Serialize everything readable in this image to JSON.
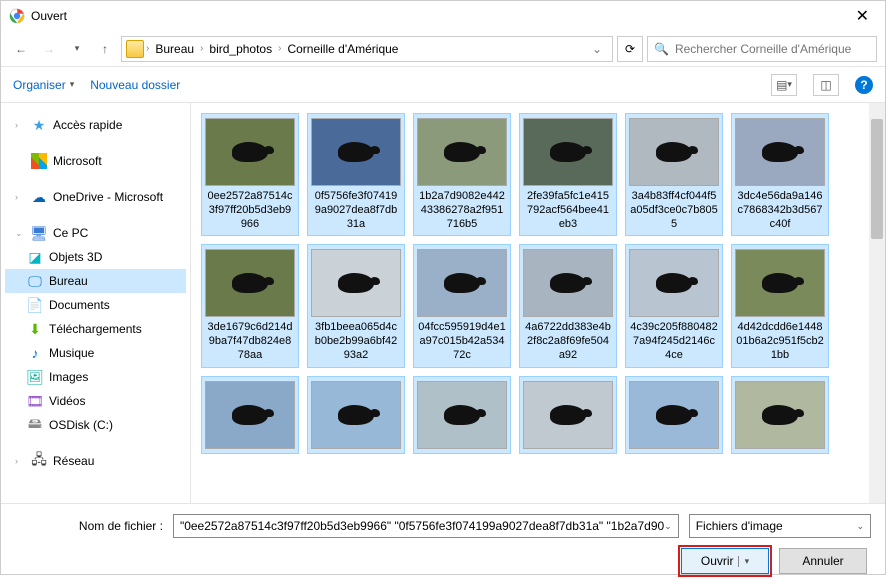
{
  "window": {
    "title": "Ouvert"
  },
  "nav": {
    "crumbs": [
      "Bureau",
      "bird_photos",
      "Corneille d'Amérique"
    ]
  },
  "search": {
    "placeholder": "Rechercher Corneille d'Amérique"
  },
  "toolbar": {
    "organize": "Organiser",
    "new_folder": "Nouveau dossier"
  },
  "sidebar": {
    "quick": "Accès rapide",
    "microsoft": "Microsoft",
    "onedrive": "OneDrive - Microsoft",
    "this_pc": "Ce PC",
    "items": [
      {
        "label": "Objets 3D"
      },
      {
        "label": "Bureau"
      },
      {
        "label": "Documents"
      },
      {
        "label": "Téléchargements"
      },
      {
        "label": "Musique"
      },
      {
        "label": "Images"
      },
      {
        "label": "Vidéos"
      },
      {
        "label": "OSDisk (C:)"
      }
    ],
    "network": "Réseau"
  },
  "files": [
    {
      "name": "0ee2572a87514c3f97ff20b5d3eb9966",
      "bg": "#6a7a4a"
    },
    {
      "name": "0f5756fe3f074199a9027dea8f7db31a",
      "bg": "#4a6a9a"
    },
    {
      "name": "1b2a7d9082e44243386278a2f951716b5",
      "bg": "#8a9a7a"
    },
    {
      "name": "2fe39fa5fc1e415792acf564bee41eb3",
      "bg": "#5a6a5a"
    },
    {
      "name": "3a4b83ff4cf044f5a05df3ce0c7b8055",
      "bg": "#b0b8c0"
    },
    {
      "name": "3dc4e56da9a146c7868342b3d567c40f",
      "bg": "#9aa8c0"
    },
    {
      "name": "3de1679c6d214d9ba7f47db824e878aa",
      "bg": "#6a7a4a"
    },
    {
      "name": "3fb1beea065d4cb0be2b99a6bf4293a2",
      "bg": "#cad2d8"
    },
    {
      "name": "04fcc595919d4e1a97c015b42a53472c",
      "bg": "#9ab0c8"
    },
    {
      "name": "4a6722dd383e4b2f8c2a8f69fe504a92",
      "bg": "#a8b4c0"
    },
    {
      "name": "4c39c205f8804827a94f245d2146c4ce",
      "bg": "#b8c4d0"
    },
    {
      "name": "4d42dcdd6e144801b6a2c951f5cb21bb",
      "bg": "#7a8a5a"
    },
    {
      "name": "",
      "bg": "#8aa8c8"
    },
    {
      "name": "",
      "bg": "#98b8d8"
    },
    {
      "name": "",
      "bg": "#b0c0c8"
    },
    {
      "name": "",
      "bg": "#c0c8d0"
    },
    {
      "name": "",
      "bg": "#9ab8d8"
    },
    {
      "name": "",
      "bg": "#b0b8a0"
    }
  ],
  "footer": {
    "filename_label": "Nom de fichier :",
    "filename_value": "\"0ee2572a87514c3f97ff20b5d3eb9966\" \"0f5756fe3f074199a9027dea8f7db31a\" \"1b2a7d90",
    "filter": "Fichiers d'image",
    "open": "Ouvrir",
    "cancel": "Annuler"
  }
}
